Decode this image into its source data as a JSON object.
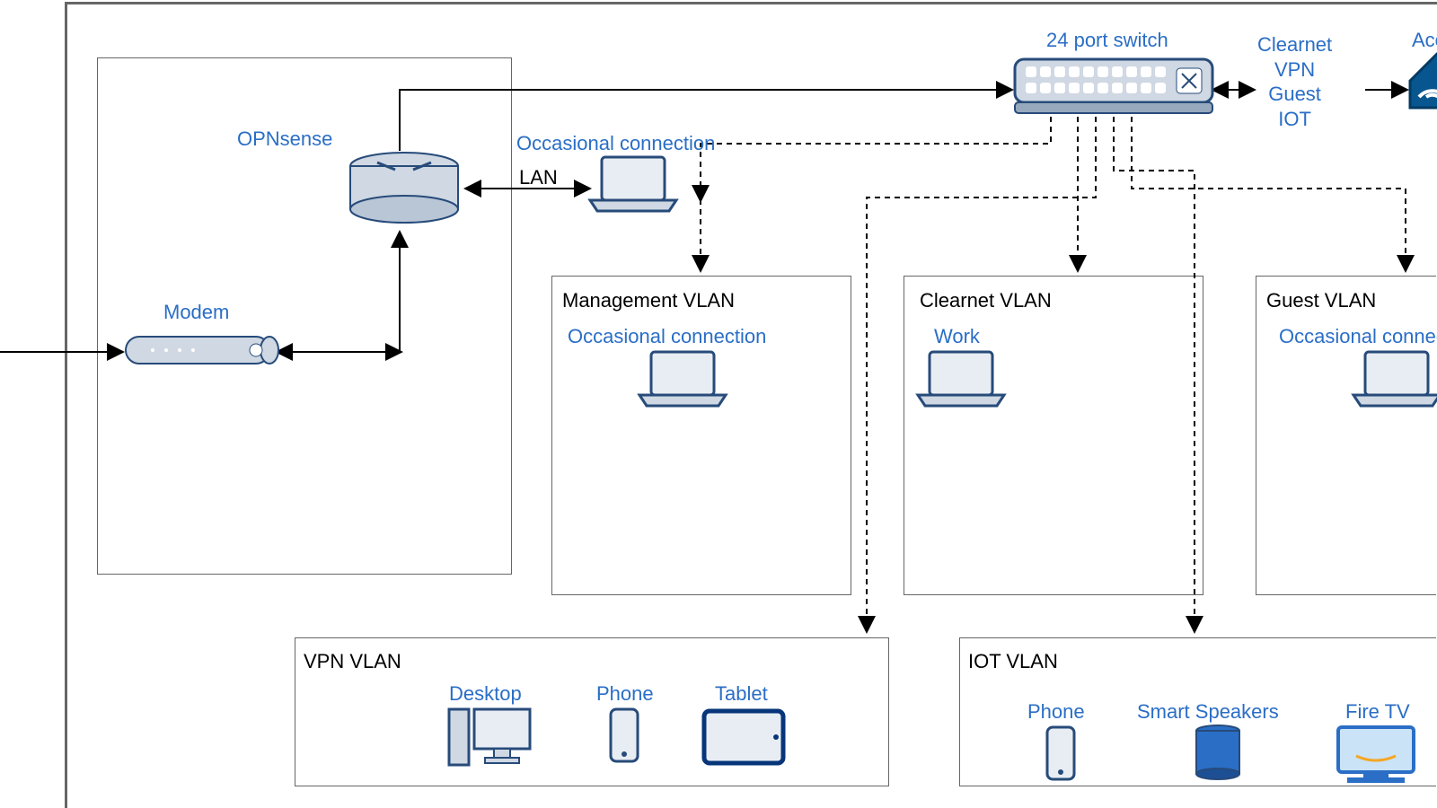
{
  "nodes": {
    "opnsense": {
      "label": "OPNsense"
    },
    "modem": {
      "label": "Modem"
    },
    "switch": {
      "label": "24 port switch"
    },
    "occ_top": {
      "label": "Occasional connection"
    },
    "lan": {
      "label": "LAN"
    },
    "trunks": {
      "lines": [
        "Clearnet",
        "VPN",
        "Guest",
        "IOT"
      ]
    },
    "acc": {
      "label": "Access"
    }
  },
  "vlans": {
    "mgmt": {
      "title": "Management VLAN",
      "devices": [
        {
          "label": "Occasional connection",
          "type": "laptop"
        }
      ]
    },
    "clear": {
      "title": "Clearnet VLAN",
      "devices": [
        {
          "label": "Work",
          "type": "laptop"
        }
      ]
    },
    "guest": {
      "title": "Guest VLAN",
      "devices": [
        {
          "label": "Occasional connection",
          "type": "laptop"
        }
      ]
    },
    "vpn": {
      "title": "VPN VLAN",
      "devices": [
        {
          "label": "Desktop",
          "type": "desktop"
        },
        {
          "label": "Phone",
          "type": "phone"
        },
        {
          "label": "Tablet",
          "type": "tablet"
        }
      ]
    },
    "iot": {
      "title": "IOT VLAN",
      "devices": [
        {
          "label": "Phone",
          "type": "phone"
        },
        {
          "label": "Smart Speakers",
          "type": "speaker"
        },
        {
          "label": "Fire TV",
          "type": "tv"
        }
      ]
    }
  }
}
